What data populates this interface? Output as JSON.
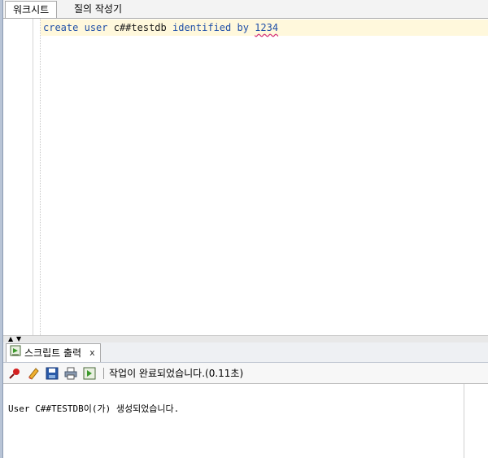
{
  "tabs": [
    {
      "label": "워크시트",
      "active": true
    },
    {
      "label": "질의 작성기",
      "active": false
    }
  ],
  "editor": {
    "line1": {
      "t1": "create",
      "t2": "user",
      "t3": "c##testdb",
      "t4": "identified",
      "t5": "by",
      "t6": "1234"
    }
  },
  "output_panel": {
    "tab_label": "스크립트 출력",
    "close_label": "x",
    "status": "작업이 완료되었습니다.(0.11초)",
    "result": "User C##TESTDB이(가) 생성되었습니다."
  },
  "icons": {
    "pin": "pushpin-icon",
    "eraser": "eraser-icon",
    "save": "save-icon",
    "print": "print-icon",
    "script": "run-script-icon"
  },
  "colors": {
    "keyword": "#1f4fa8",
    "current_line": "#fff8dc",
    "spell_underline": "#d4307a"
  }
}
